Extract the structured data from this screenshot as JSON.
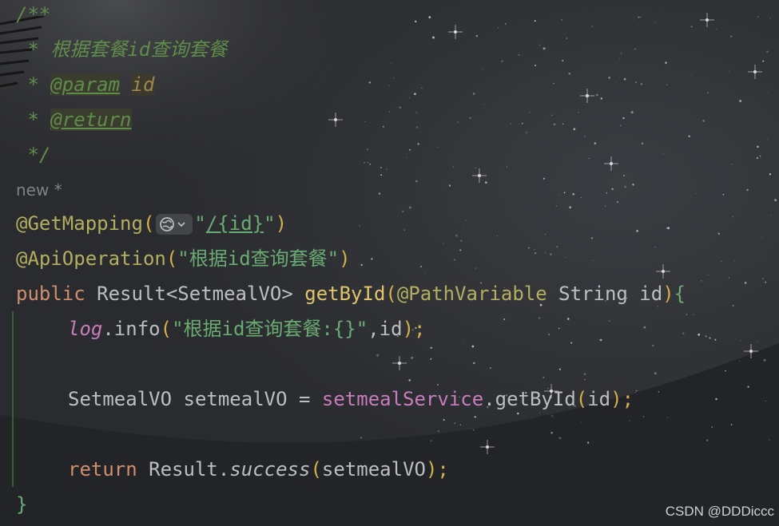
{
  "editor": {
    "lines": {
      "l1": "/**",
      "l2": " * 根据套餐id查询套餐",
      "l3_star": " * ",
      "l3_tag": "@param",
      "l3_param": "id",
      "l4_star": " * ",
      "l4_tag": "@return",
      "l5": " */",
      "inlay_new": "new *",
      "l7_ann": "@GetMapping",
      "l7_open": "(",
      "l7_q1": "\"",
      "l7_path": "/{id}",
      "l7_q2": "\"",
      "l7_close": ")",
      "l8_ann": "@ApiOperation",
      "l8_open": "(",
      "l8_str": "\"根据id查询套餐\"",
      "l8_close": ")",
      "l9_kw": "public ",
      "l9_type": "Result<SetmealVO> ",
      "l9_method": "getById",
      "l9_open": "(",
      "l9_ann": "@PathVariable",
      "l9_rest": " String id",
      "l9_close": ")",
      "l9_brace": "{",
      "l10_log": "log",
      "l10_call": ".info",
      "l10_open": "(",
      "l10_str": "\"根据id查询套餐:{}\"",
      "l10_arg": ",id",
      "l10_close": ");",
      "l12_decl": "SetmealVO setmealVO = ",
      "l12_field": "setmealService",
      "l12_call": ".getById",
      "l12_open": "(",
      "l12_arg": "id",
      "l12_close": ");",
      "l14_kw": "return ",
      "l14_cls": "Result.",
      "l14_method": "success",
      "l14_open": "(",
      "l14_arg": "setmealVO",
      "l14_close": ");",
      "l15": "}"
    },
    "icons": {
      "globe": "globe-icon",
      "chevron": "chevron-down-icon"
    }
  },
  "watermark": "CSDN @DDDiccc"
}
